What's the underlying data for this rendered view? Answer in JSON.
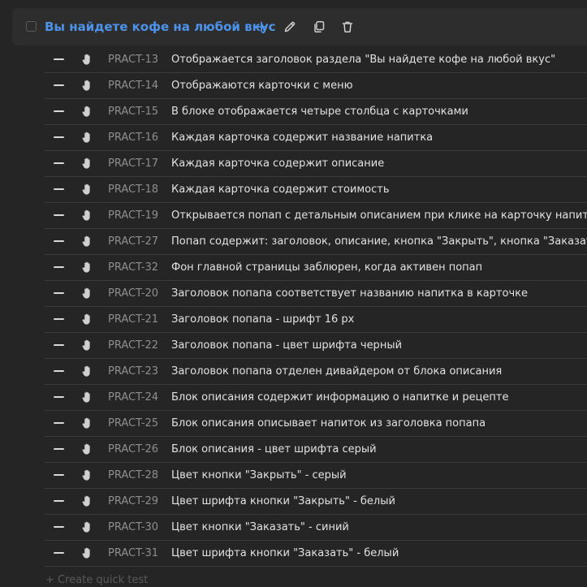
{
  "suite": {
    "title": "Вы найдете кофе на любой вкус",
    "icons": [
      "plus-icon",
      "pencil-icon",
      "copy-icon",
      "trash-icon"
    ]
  },
  "colors": {
    "accent": "#4d93ea",
    "background": "#252526",
    "header_bg": "#2d2d2e",
    "text": "#e2e2e2",
    "muted": "#8e8e90"
  },
  "row_icons": [
    "minus-icon",
    "hand-icon"
  ],
  "tests": [
    {
      "id": "PRACT-13",
      "title": "Отображается заголовок раздела \"Вы найдете кофе на любой вкус\""
    },
    {
      "id": "PRACT-14",
      "title": "Отображаются карточки с меню"
    },
    {
      "id": "PRACT-15",
      "title": "В блоке отображается четыре столбца с карточками"
    },
    {
      "id": "PRACT-16",
      "title": "Каждая карточка содержит название напитка"
    },
    {
      "id": "PRACT-17",
      "title": "Каждая карточка содержит описание"
    },
    {
      "id": "PRACT-18",
      "title": "Каждая карточка содержит стоимость"
    },
    {
      "id": "PRACT-19",
      "title": "Открывается попап с детальным описанием при клике на карточку напитка"
    },
    {
      "id": "PRACT-27",
      "title": "Попап содержит: заголовок, описание, кнопка \"Закрыть\", кнопка \"Заказать\""
    },
    {
      "id": "PRACT-32",
      "title": "Фон главной страницы заблюрен, когда активен попап"
    },
    {
      "id": "PRACT-20",
      "title": "Заголовок попапа соответствует названию напитка в карточке"
    },
    {
      "id": "PRACT-21",
      "title": "Заголовок попапа - шрифт 16 px"
    },
    {
      "id": "PRACT-22",
      "title": "Заголовок попапа - цвет шрифта черный"
    },
    {
      "id": "PRACT-23",
      "title": "Заголовок попапа отделен дивайдером от блока описания"
    },
    {
      "id": "PRACT-24",
      "title": "Блок описания содержит информацию о напитке и рецепте"
    },
    {
      "id": "PRACT-25",
      "title": "Блок описания описывает напиток из заголовка попапа"
    },
    {
      "id": "PRACT-26",
      "title": "Блок описания - цвет шрифта серый"
    },
    {
      "id": "PRACT-28",
      "title": "Цвет кнопки \"Закрыть\" - серый"
    },
    {
      "id": "PRACT-29",
      "title": "Цвет шрифта кнопки \"Закрыть\" - белый"
    },
    {
      "id": "PRACT-30",
      "title": "Цвет кнопки \"Заказать\" - синий"
    },
    {
      "id": "PRACT-31",
      "title": "Цвет шрифта кнопки \"Заказать\" - белый"
    }
  ],
  "quick_test": {
    "label": "+ Create quick test"
  }
}
